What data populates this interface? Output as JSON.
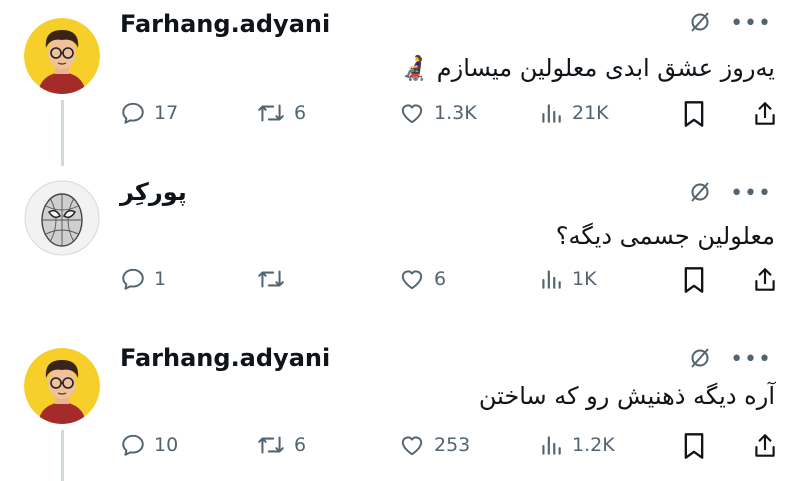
{
  "tweets": [
    {
      "author": "Farhang.adyani",
      "text": "یه‌روز عشق ابدی معلولین میسازم 👩‍🦼",
      "replies": "17",
      "retweets": "6",
      "likes": "1.3K",
      "views": "21K"
    },
    {
      "author": "پورکِر",
      "text": "معلولین جسمی دیگه؟",
      "replies": "1",
      "retweets": "",
      "likes": "6",
      "views": "1K"
    },
    {
      "author": "Farhang.adyani",
      "text": "آره دیگه ذهنیش رو که ساختن",
      "replies": "10",
      "retweets": "6",
      "likes": "253",
      "views": "1.2K"
    }
  ],
  "icons": {
    "reply": "reply-icon",
    "retweet": "retweet-icon",
    "like": "heart-icon",
    "views": "views-icon",
    "bookmark": "bookmark-icon",
    "share": "share-icon",
    "grok": "grok-icon",
    "more": "more-icon"
  },
  "colors": {
    "text": "#0f1419",
    "muted": "#536471",
    "avatar_yellow": "#f7cf2a",
    "thread_line": "#cfd9de"
  }
}
